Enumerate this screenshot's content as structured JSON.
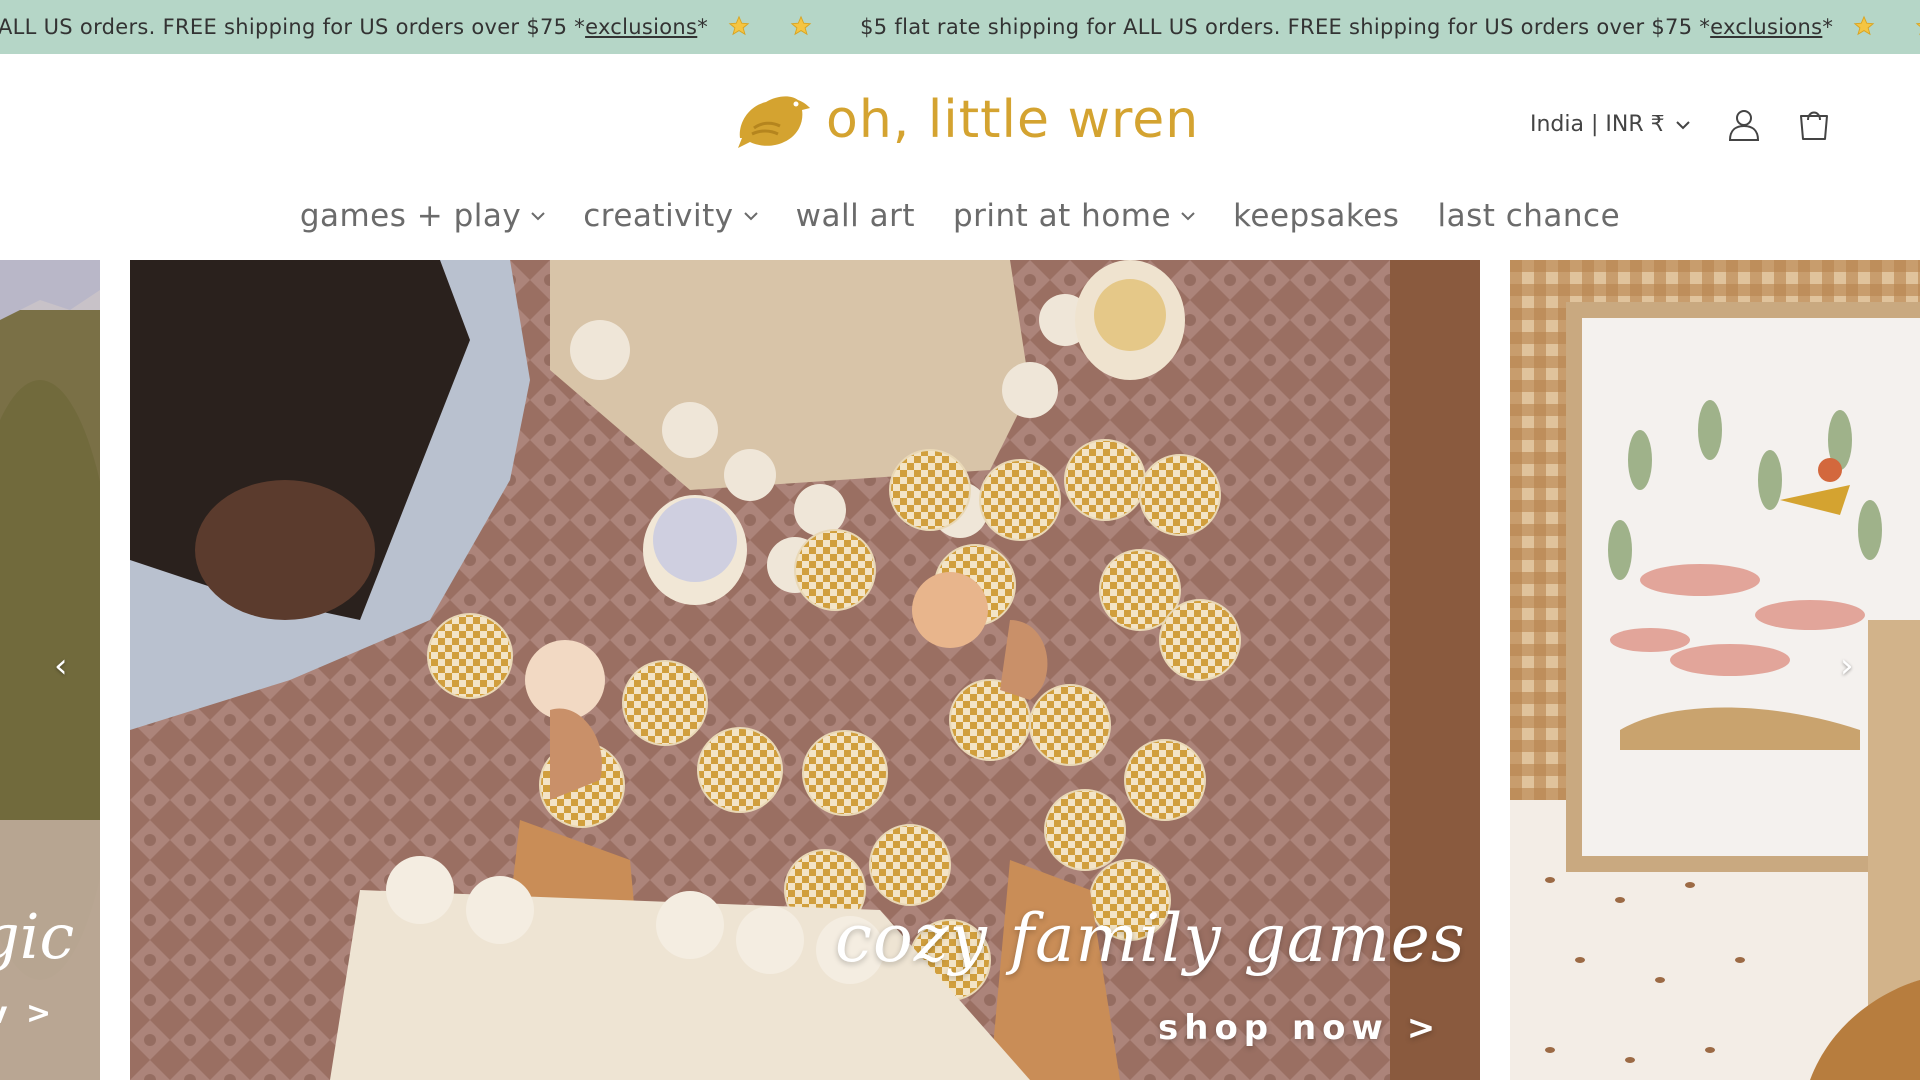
{
  "announcement": {
    "items": [
      {
        "text": "ALL US orders. FREE shipping for US orders over $75 *",
        "link": "exclusions",
        "suffix": "*"
      },
      {
        "text": "$5 flat rate shipping for ALL US orders. FREE shipping for US orders over $75 *",
        "link": "exclusions",
        "suffix": "*"
      },
      {
        "text": "$",
        "link": "",
        "suffix": ""
      }
    ],
    "background": "#b5d6c7",
    "icon": "star-icon"
  },
  "header": {
    "logo_text": "oh, little wren",
    "logo_color": "#d4a330",
    "locale": "India | INR ₹",
    "icons": [
      "account-icon",
      "cart-icon"
    ]
  },
  "nav": {
    "items": [
      {
        "label": "games + play",
        "has_dropdown": true
      },
      {
        "label": "creativity",
        "has_dropdown": true
      },
      {
        "label": "wall art",
        "has_dropdown": false
      },
      {
        "label": "print at home",
        "has_dropdown": true
      },
      {
        "label": "keepsakes",
        "has_dropdown": false
      },
      {
        "label": "last chance",
        "has_dropdown": false
      }
    ]
  },
  "carousel": {
    "prev_label": "‹",
    "next_label": "›",
    "prev_slide": {
      "title_fragment": "gic",
      "cta_fragment": "v >"
    },
    "current_slide": {
      "title": "cozy family games",
      "cta": "shop now >"
    }
  }
}
